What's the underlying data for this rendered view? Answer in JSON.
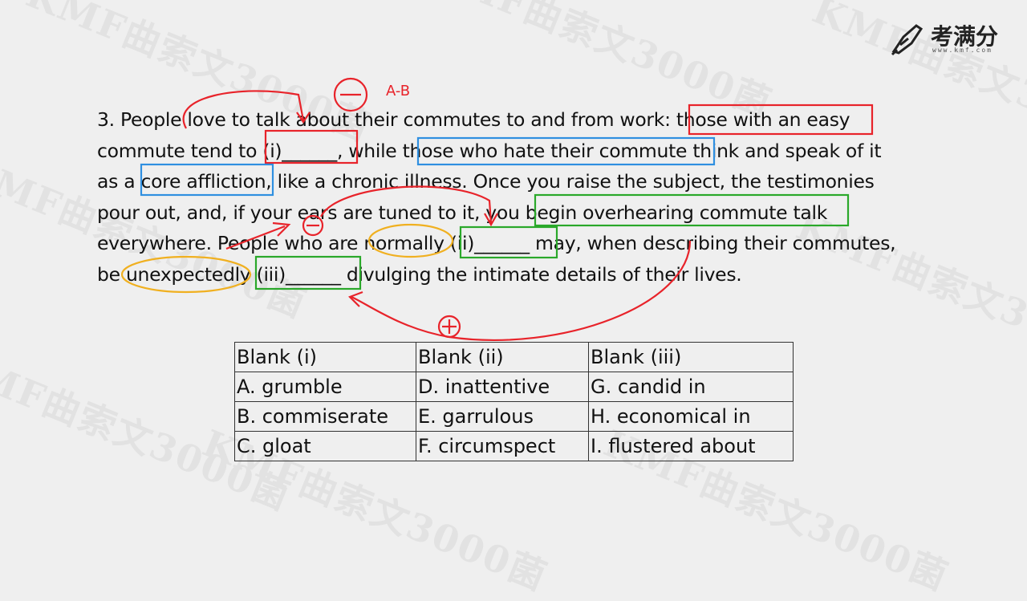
{
  "watermark": "KMF曲索文3000菌",
  "logo": {
    "name": "考满分",
    "url": "www.kmf.com"
  },
  "annotations": {
    "ab_label": "A-B"
  },
  "passage": {
    "line1": "3. People love to talk about their commutes to and from work: those with an easy",
    "line2": "commute tend to (i)______, while those who hate their commute think and speak of it",
    "line3": "as a core affliction, like a chronic illness. Once you raise the subject, the testimonies",
    "line4": "pour out, and, if your ears are tuned to it, you begin overhearing commute talk",
    "line5": "everywhere. People who are normally (ii)______ may, when describing their commutes,",
    "line6": "be unexpectedly (iii)______ divulging the intimate details of their lives."
  },
  "table": {
    "headers": [
      "Blank (i)",
      "Blank (ii)",
      "Blank (iii)"
    ],
    "rows": [
      [
        "A. grumble",
        "D. inattentive",
        "G. candid in"
      ],
      [
        "B. commiserate",
        "E. garrulous",
        "H. economical in"
      ],
      [
        "C. gloat",
        "F. circumspect",
        "I. flustered about"
      ]
    ]
  },
  "colors": {
    "red": "#e8232a",
    "blue": "#2f8fe0",
    "green": "#2aa82a",
    "orange": "#f0b020",
    "background": "#efefef"
  }
}
